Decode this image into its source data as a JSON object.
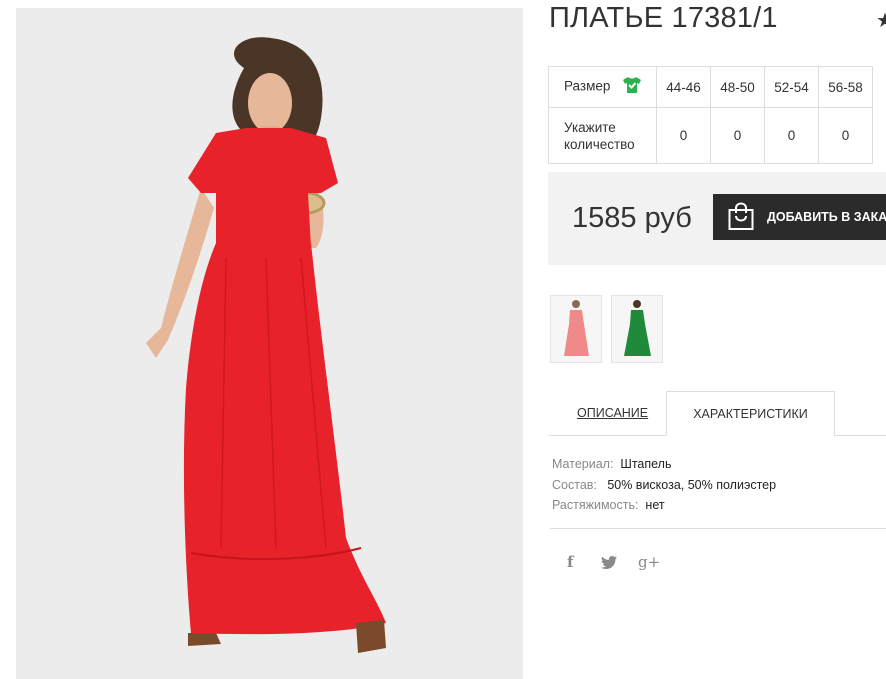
{
  "product": {
    "title": "ПЛАТЬЕ 17381/1",
    "price": "1585 руб",
    "add_button": "ДОБАВИТЬ В ЗАКАЗ"
  },
  "sizes": {
    "size_label": "Размер",
    "qty_label": "Укажите количество",
    "columns": [
      "44-46",
      "48-50",
      "52-54",
      "56-58"
    ],
    "quantities": [
      "0",
      "0",
      "0",
      "0"
    ]
  },
  "thumbnails": [
    {
      "name": "pink-dress-thumbnail",
      "color": "#f08a8a"
    },
    {
      "name": "green-dress-thumbnail",
      "color": "#1f8a3a"
    }
  ],
  "tabs": {
    "description": "ОПИСАНИЕ",
    "characteristics": "ХАРАКТЕРИСТИКИ"
  },
  "specs": [
    {
      "key": "Материал:",
      "value": "Штапель"
    },
    {
      "key": "Состав:",
      "value": "50% вискоза, 50% полиэстер"
    },
    {
      "key": "Растяжимость:",
      "value": "нет"
    }
  ],
  "social": {
    "facebook": "f",
    "twitter": "twitter-icon",
    "googleplus": "g+"
  },
  "colors": {
    "dress": "#e8222a",
    "button_bg": "#2b2b2b",
    "size_icon": "#2bb24c"
  }
}
